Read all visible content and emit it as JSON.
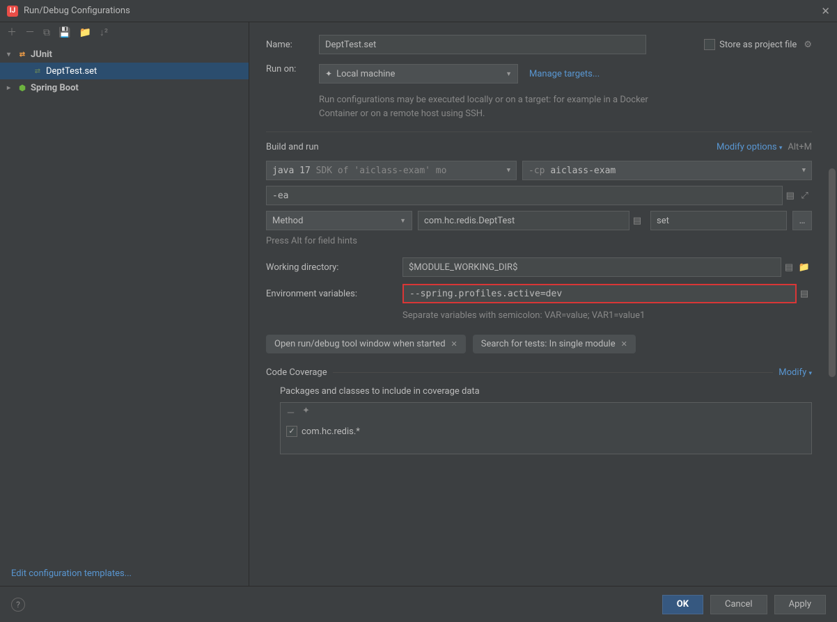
{
  "window": {
    "title": "Run/Debug Configurations"
  },
  "sidebar": {
    "items": [
      {
        "label": "JUnit",
        "type": "junit",
        "expanded": true
      },
      {
        "label": "DeptTest.set",
        "type": "file",
        "selected": true
      },
      {
        "label": "Spring Boot",
        "type": "spring",
        "expanded": false
      }
    ],
    "edit_templates": "Edit configuration templates..."
  },
  "form": {
    "name_label": "Name:",
    "name_value": "DeptTest.set",
    "store_label": "Store as project file",
    "runon_label": "Run on:",
    "runon_value": "Local machine",
    "manage_targets": "Manage targets...",
    "runon_hint": "Run configurations may be executed locally or on a target: for example in a Docker Container or on a remote host using SSH.",
    "build_run": "Build and run",
    "modify_options": "Modify options",
    "alt_m": "Alt+M",
    "jdk_prefix": "java 17",
    "jdk_rest": " SDK of 'aiclass-exam' mo",
    "cp_prefix": "-cp ",
    "cp_value": "aiclass-exam",
    "vm_options": "-ea",
    "testtype": "Method",
    "test_class": "com.hc.redis.DeptTest",
    "test_method": "set",
    "field_hints": "Press Alt for field hints",
    "wd_label": "Working directory:",
    "wd_value": "$MODULE_WORKING_DIR$",
    "env_label": "Environment variables:",
    "env_value": "--spring.profiles.active=dev",
    "env_hint": "Separate variables with semicolon: VAR=value; VAR1=value1",
    "pill1": "Open run/debug tool window when started",
    "pill2": "Search for tests: In single module",
    "coverage_title": "Code Coverage",
    "coverage_modify": "Modify",
    "coverage_sub": "Packages and classes to include in coverage data",
    "coverage_item": "com.hc.redis.*"
  },
  "footer": {
    "ok": "OK",
    "cancel": "Cancel",
    "apply": "Apply"
  }
}
